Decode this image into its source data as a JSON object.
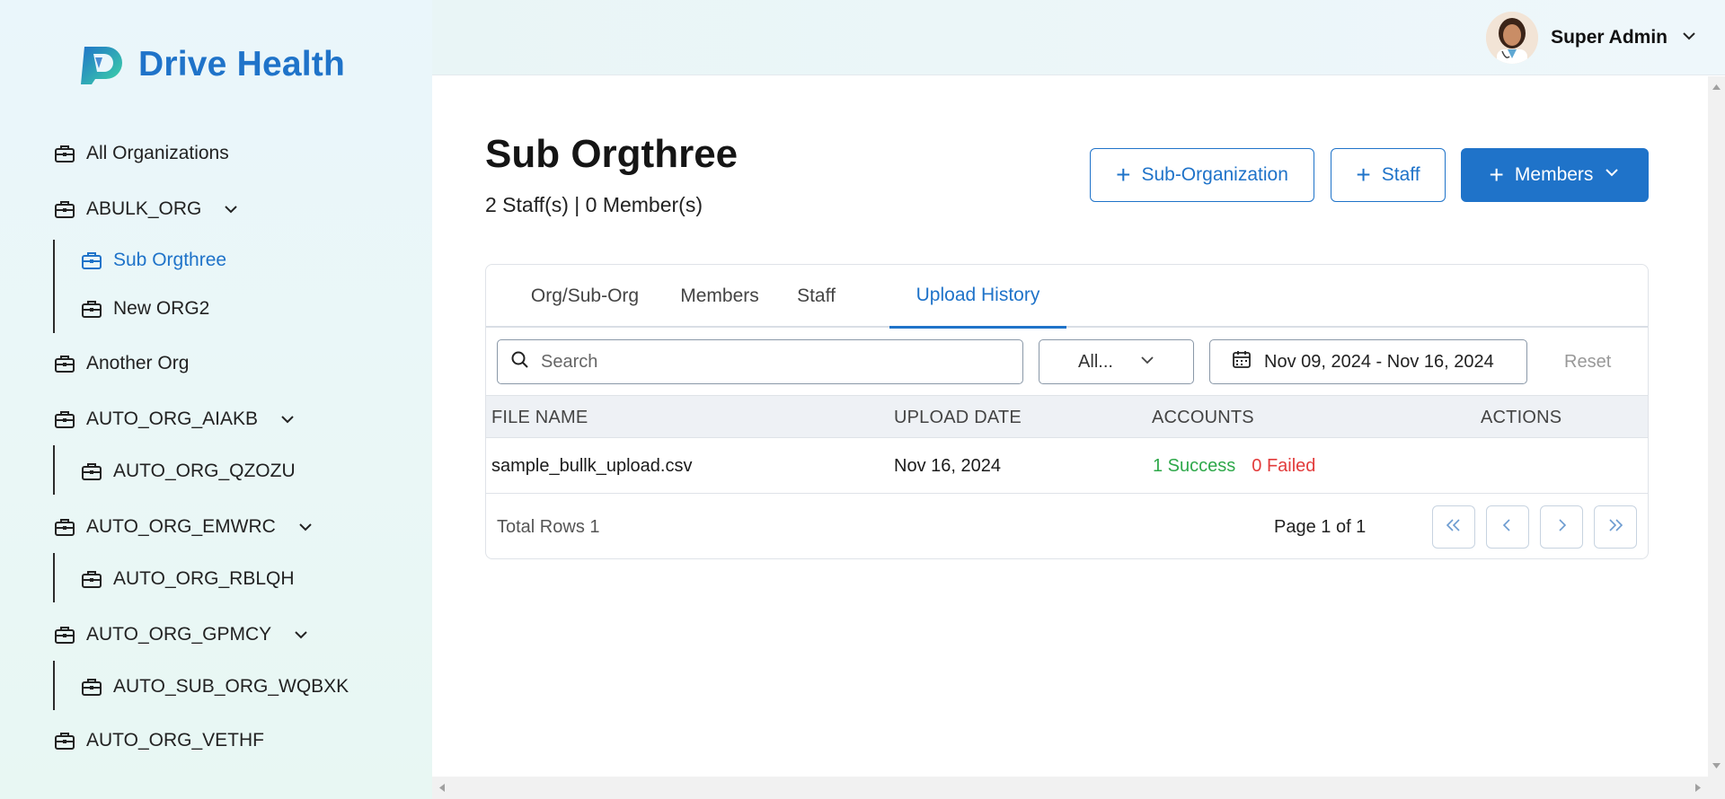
{
  "brand": {
    "name": "Drive Health",
    "color": "#1f73c9"
  },
  "sidebar": {
    "items": [
      {
        "label": "All Organizations",
        "icon": "briefcase-icon"
      },
      {
        "label": "ABULK_ORG",
        "icon": "briefcase-icon",
        "expandable": true
      },
      {
        "label": "Sub Orgthree",
        "icon": "briefcase-icon",
        "active": true
      },
      {
        "label": "New ORG2",
        "icon": "briefcase-icon"
      },
      {
        "label": "Another Org",
        "icon": "briefcase-icon"
      },
      {
        "label": "AUTO_ORG_AIAKB",
        "icon": "briefcase-icon",
        "expandable": true
      },
      {
        "label": "AUTO_ORG_QZOZU",
        "icon": "briefcase-icon"
      },
      {
        "label": "AUTO_ORG_EMWRC",
        "icon": "briefcase-icon",
        "expandable": true
      },
      {
        "label": "AUTO_ORG_RBLQH",
        "icon": "briefcase-icon"
      },
      {
        "label": "AUTO_ORG_GPMCY",
        "icon": "briefcase-icon",
        "expandable": true
      },
      {
        "label": "AUTO_SUB_ORG_WQBXK",
        "icon": "briefcase-icon"
      },
      {
        "label": "AUTO_ORG_VETHF",
        "icon": "briefcase-icon"
      }
    ]
  },
  "header": {
    "user_name": "Super Admin"
  },
  "page": {
    "title": "Sub Orgthree",
    "subtitle": "2 Staff(s) | 0 Member(s)",
    "buttons": {
      "sub_org": "Sub-Organization",
      "staff": "Staff",
      "members": "Members"
    }
  },
  "tabs": [
    {
      "label": "Org/Sub-Org"
    },
    {
      "label": "Members"
    },
    {
      "label": "Staff"
    },
    {
      "label": "Upload History",
      "active": true
    }
  ],
  "filters": {
    "search_placeholder": "Search",
    "status_select": "All...",
    "date_range": "Nov 09, 2024 - Nov 16, 2024",
    "reset": "Reset"
  },
  "table": {
    "columns": [
      "FILE NAME",
      "UPLOAD DATE",
      "ACCOUNTS",
      "ACTIONS"
    ],
    "rows": [
      {
        "file_name": "sample_bullk_upload.csv",
        "upload_date": "Nov 16, 2024",
        "success": "1 Success",
        "failed": "0 Failed"
      }
    ],
    "total_rows": "Total Rows 1",
    "page_info": "Page 1 of 1"
  },
  "colors": {
    "success": "#2ea84a",
    "failed": "#e23b3b",
    "primary": "#1f73c9"
  }
}
